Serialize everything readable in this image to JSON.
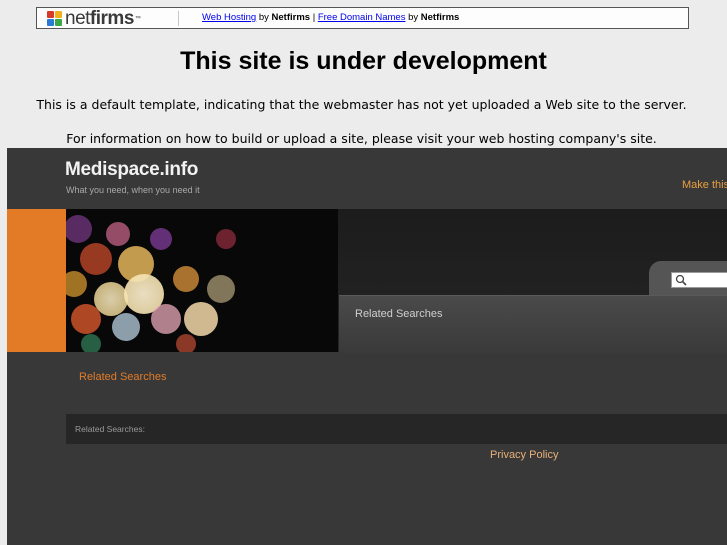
{
  "banner": {
    "logo_net": "net",
    "logo_firms": "firms",
    "logo_tm": "™",
    "link1": "Web Hosting",
    "by1": " by ",
    "brand1": "Netfirms",
    "sep": " | ",
    "link2": "Free Domain Names",
    "by2": " by ",
    "brand2": "Netfirms"
  },
  "notice": {
    "title": "This site is under development",
    "line1": "This is a default template, indicating that the webmaster has not yet uploaded a Web site to the server.",
    "line2": "For information on how to build or upload a site, please visit your web hosting company's site."
  },
  "parked": {
    "site_title": "Medispace.info",
    "tagline": "What you need, when you need it",
    "bookmark_link": "Make this",
    "search_placeholder": "",
    "related_panel_label": "Related Searches",
    "related_link": "Related Searches",
    "related_bar_label": "Related Searches:",
    "privacy_link": "Privacy Policy"
  },
  "colors": {
    "orange_accent": "#e37b26",
    "frame_bg": "#383838",
    "link_blue": "#0000ee"
  }
}
